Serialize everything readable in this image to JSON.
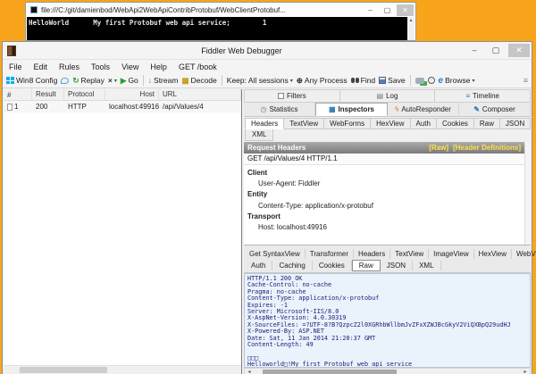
{
  "icons": {
    "caret_down": "▾",
    "play": "▶",
    "down_arrow": "↓",
    "replay": "↻",
    "times": "×",
    "grid": "▦",
    "target": "⊕",
    "lightning": "ϟ",
    "pencil": "✎",
    "clock": "◷",
    "menu_lines": "≡",
    "page": "▤",
    "left_arrow": "◂",
    "right_arrow": "▸",
    "up_arrow": "▴",
    "timer_dot": "·",
    "ie_e": "e"
  },
  "console_window": {
    "title": "file:///C:/git/damienbod/WebApi2WebApiContribProtobuf/WebClientProtobuf...",
    "minimize": "–",
    "maximize": "▢",
    "close": "✕",
    "output": "HelloWorld      My first Protobuf web api service;        1"
  },
  "fiddler": {
    "title": "Fiddler Web Debugger",
    "minimize": "–",
    "maximize": "▢",
    "close": "✕",
    "menu": [
      "File",
      "Edit",
      "Rules",
      "Tools",
      "View",
      "Help",
      "GET /book"
    ],
    "toolbar": {
      "win8_config": "Win8 Config",
      "replay": "Replay",
      "go": "Go",
      "stream": "Stream",
      "decode": "Decode",
      "keep": "Keep: All sessions",
      "any_process": "Any Process",
      "find": "Find",
      "save": "Save",
      "browse": "Browse"
    },
    "session_list": {
      "columns": [
        "#",
        "Result",
        "Protocol",
        "Host",
        "URL"
      ],
      "row": {
        "num": "1",
        "result": "200",
        "protocol": "HTTP",
        "host": "localhost:49916",
        "url": "/api/Values/4"
      }
    },
    "panel_tabs_top": [
      "Filters",
      "Log",
      "Timeline"
    ],
    "main_tabs": [
      "Statistics",
      "Inspectors",
      "AutoResponder",
      "Composer"
    ],
    "request_tabs": [
      "Headers",
      "TextView",
      "WebForms",
      "HexView",
      "Auth",
      "Cookies",
      "Raw",
      "JSON"
    ],
    "request_tabs_row2": [
      "XML"
    ],
    "request_headers": {
      "title": "Request Headers",
      "raw_link": "[Raw]",
      "defs_link": "[Header Definitions]",
      "request_line": "GET /api/Values/4 HTTP/1.1",
      "groups": [
        {
          "name": "Client",
          "items": [
            "User-Agent: Fiddler"
          ]
        },
        {
          "name": "Entity",
          "items": [
            "Content-Type: application/x-protobuf"
          ]
        },
        {
          "name": "Transport",
          "items": [
            "Host: localhost:49916"
          ]
        }
      ]
    },
    "response_tabs_row1": [
      "Get SyntaxView",
      "Transformer",
      "Headers",
      "TextView",
      "ImageView",
      "HexView",
      "WebView"
    ],
    "response_tabs_row2": [
      "Auth",
      "Caching",
      "Cookies",
      "Raw",
      "JSON",
      "XML"
    ],
    "response_raw": [
      "HTTP/1.1 200 OK",
      "Cache-Control: no-cache",
      "Pragma: no-cache",
      "Content-Type: application/x-protobuf",
      "Expires: -1",
      "Server: Microsoft-IIS/8.0",
      "X-AspNet-Version: 4.0.30319",
      "X-SourceFiles: =?UTF-8?B?QzpcZ2l0XGRhbWllbmJvZFxXZWJBcGkyV2ViQXBpQ29udHJ",
      "X-Powered-By: ASP.NET",
      "Date: Sat, 11 Jan 2014 21:20:37 GMT",
      "Content-Length: 49",
      "",
      "□□□",
      "Helloworld□!My first Protobuf web api service"
    ]
  }
}
